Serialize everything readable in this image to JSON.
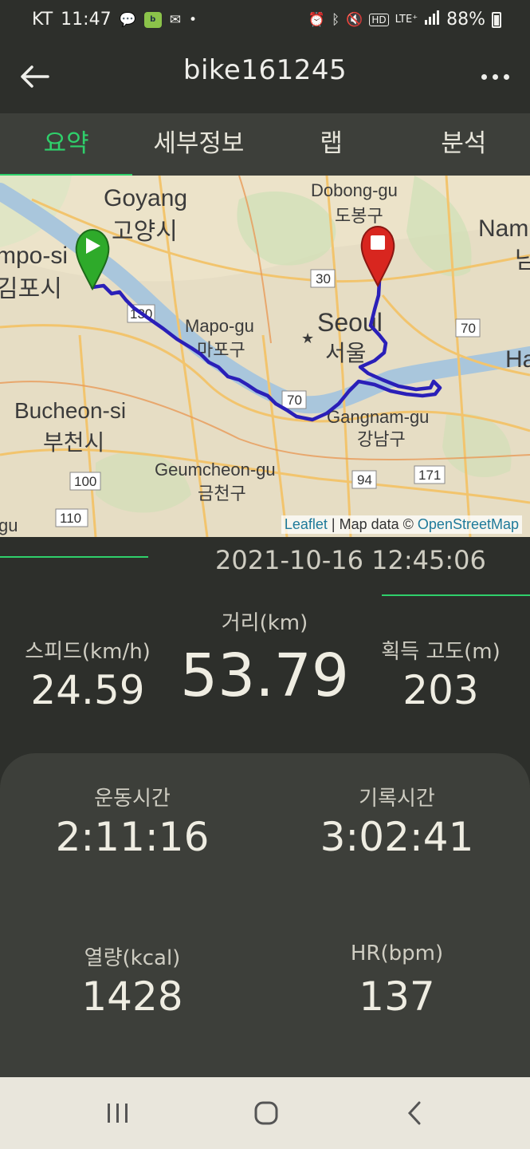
{
  "status_bar": {
    "carrier": "KT",
    "time": "11:47",
    "notif_icons": [
      "talk-icon",
      "app-icon",
      "mail-icon",
      "dot-icon"
    ],
    "sys_icons": [
      "alarm-icon",
      "bluetooth-icon",
      "mute-icon",
      "hd-icon",
      "lte-icon",
      "signal-icon"
    ],
    "battery": "88%"
  },
  "header": {
    "title": "bike161245"
  },
  "tabs": [
    {
      "label": "요약",
      "active": true
    },
    {
      "label": "세부정보",
      "active": false
    },
    {
      "label": "랩",
      "active": false
    },
    {
      "label": "분석",
      "active": false
    }
  ],
  "map": {
    "labels": {
      "goyang_en": "Goyang",
      "goyang_ko": "고양시",
      "gimpo_en": "mpo-si",
      "gimpo_ko": "김포시",
      "dobong_en": "Dobong-gu",
      "dobong_ko": "도봉구",
      "nam": "Nam",
      "nam_ko": "남",
      "mapo_en": "Mapo-gu",
      "mapo_ko": "마포구",
      "seoul_en": "Seoul",
      "seoul_ko": "서울",
      "ha": "Ha",
      "bucheon_en": "Bucheon-si",
      "bucheon_ko": "부천시",
      "gangnam_en": "Gangnam-gu",
      "gangnam_ko": "강남구",
      "geumcheon_en": "Geumcheon-gu",
      "geumcheon_ko": "금천구",
      "gu": "gu"
    },
    "road_shields": {
      "r30": "30",
      "r130": "130",
      "r70a": "70",
      "r70b": "70",
      "r100": "100",
      "r110": "110",
      "r94": "94",
      "r171": "171"
    },
    "attribution": {
      "leaflet": "Leaflet",
      "mapdata": "| Map data ©",
      "osm": "OpenStreetMap"
    },
    "route_color": "#2a1fb8",
    "start_marker_color": "#2eaa2a",
    "end_marker_color": "#d8261f"
  },
  "summary": {
    "datetime": "2021-10-16 12:45:06",
    "speed_label": "스피드(km/h)",
    "speed_value": "24.59",
    "distance_label": "거리(km)",
    "distance_value": "53.79",
    "elevation_label": "획득 고도(m)",
    "elevation_value": "203"
  },
  "card": {
    "moving_time_label": "운동시간",
    "moving_time_value": "2:11:16",
    "elapsed_time_label": "기록시간",
    "elapsed_time_value": "3:02:41",
    "calories_label": "열량(kcal)",
    "calories_value": "1428",
    "hr_label": "HR(bpm)",
    "hr_value": "137"
  },
  "nav_bar": {
    "buttons": [
      "recent-apps-icon",
      "home-icon",
      "back-icon"
    ]
  },
  "colors": {
    "accent": "#2fd06b",
    "background": "#2d2f2b",
    "card": "#3d3f3a"
  }
}
